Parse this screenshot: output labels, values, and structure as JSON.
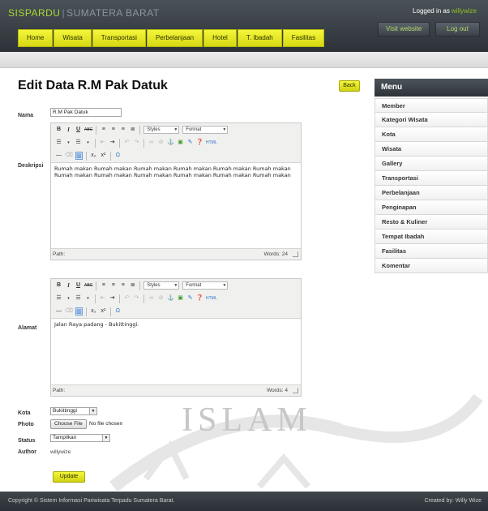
{
  "header": {
    "brand_part1": "SISPARDU",
    "brand_separator": "|",
    "brand_part2": "SUMATERA BARAT",
    "logged_in_prefix": "Logged in as",
    "logged_in_user": "willywize",
    "visit_website": "Visit website",
    "logout": "Log out"
  },
  "nav": [
    "Home",
    "Wisata",
    "Transportasi",
    "Perbelanjaan",
    "Hotel",
    "T. Ibadah",
    "Fasilitas"
  ],
  "page": {
    "title": "Edit Data R.M Pak Datuk",
    "back_label": "Back"
  },
  "form": {
    "nama_label": "Nama",
    "nama_value": "R.M Pak Datuk",
    "deskripsi_label": "Deskripsi",
    "deskripsi_text": "Rumah makan Rumah makan Rumah makan Rumah makan Rumah makan Rumah makan Rumah makan Rumah makan Rumah makan Rumah makan Rumah makan Rumah makan",
    "alamat_label": "Alamat",
    "alamat_text": "Jalan Raya padang -  Bukittinggi.",
    "path_label": "Path:",
    "deskripsi_words": "Words: 24",
    "alamat_words": "Words: 4",
    "styles_label": "Styles",
    "format_label": "Format",
    "kota_label": "Kota",
    "kota_value": "Bukittinggi",
    "photo_label": "Photo",
    "choose_file": "Choose File",
    "no_file": "No file chosen",
    "status_label": "Status",
    "status_value": "Tampilkan",
    "author_label": "Author",
    "author_value": "willywize",
    "update_label": "Update"
  },
  "sidebar": {
    "title": "Menu",
    "items": [
      "Member",
      "Kategori Wisata",
      "Kota",
      "Wisata",
      "Gallery",
      "Transportasi",
      "Perbelanjaan",
      "Penginapan",
      "Resto & Kuliner",
      "Tempat Ibadah",
      "Fasilitas",
      "Komentar"
    ]
  },
  "watermark": "ISLAM",
  "footer": {
    "copyright": "Copyright © Sistem Informasi Pariwisata Terpadu Sumatera Barat.",
    "credit": "Created by: Willy Wize"
  }
}
